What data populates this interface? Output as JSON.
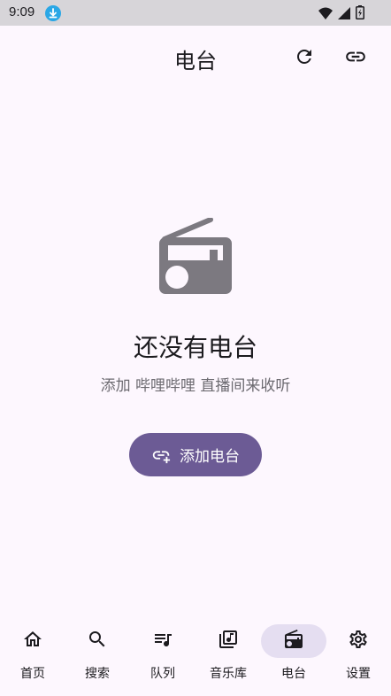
{
  "status_bar": {
    "time": "9:09"
  },
  "app_bar": {
    "title": "电台"
  },
  "empty_state": {
    "title": "还没有电台",
    "subtitle": "添加 哔哩哔哩 直播间来收听",
    "add_button_label": "添加电台"
  },
  "bottom_nav": {
    "items": [
      {
        "label": "首页",
        "icon": "home-icon"
      },
      {
        "label": "搜索",
        "icon": "search-icon"
      },
      {
        "label": "队列",
        "icon": "queue-icon"
      },
      {
        "label": "音乐库",
        "icon": "library-icon"
      },
      {
        "label": "电台",
        "icon": "radio-icon",
        "active": true
      },
      {
        "label": "设置",
        "icon": "gear-icon"
      }
    ]
  },
  "colors": {
    "accent": "#6c5b95",
    "active_pill": "#e5def1",
    "background": "#fdf7fe",
    "status_bar": "#d7d5d9"
  }
}
